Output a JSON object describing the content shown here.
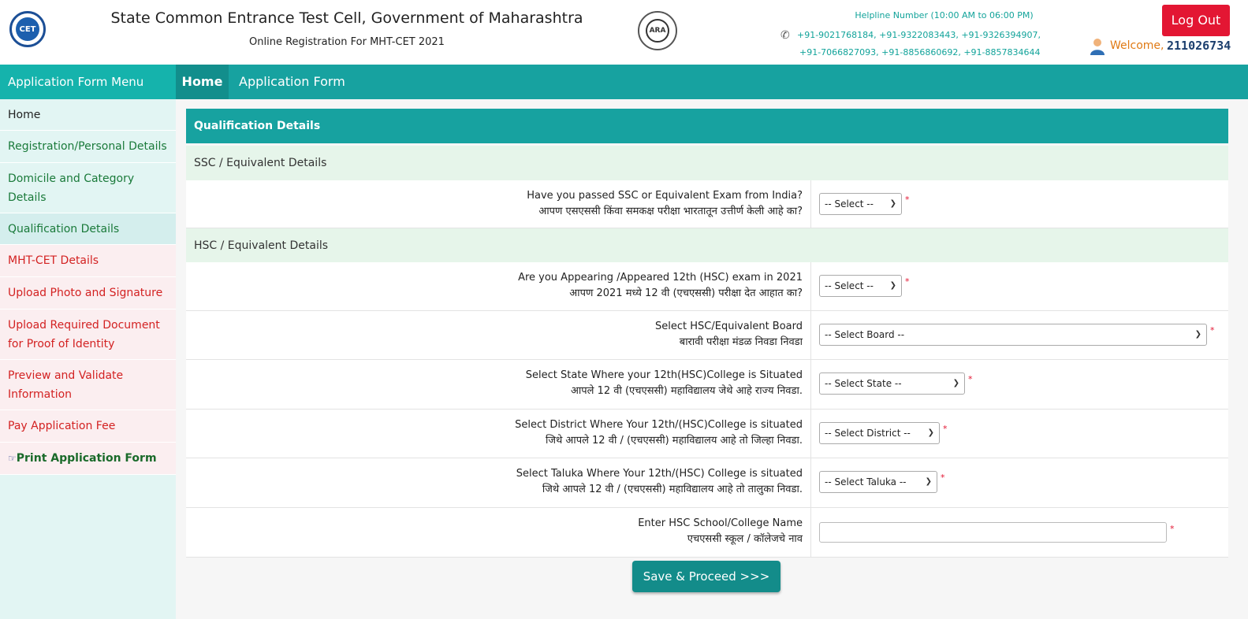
{
  "header": {
    "title": "State Common Entrance Test Cell, Government of Maharashtra",
    "subtitle": "Online Registration For MHT-CET 2021",
    "cet_logo_text": "CET",
    "ara_logo_text": "ARA",
    "helpline_title": "Helpline Number (10:00 AM to 06:00 PM)",
    "helpline_line1": "+91-9021768184, +91-9322083443, +91-9326394907,",
    "helpline_line2": "+91-7066827093, +91-8856860692, +91-8857834644",
    "logout_label": "Log Out",
    "welcome_label": "Welcome,",
    "user_id": "211026734"
  },
  "nav": {
    "sidebar_title": "Application Form Menu",
    "tabs": [
      {
        "label": "Home",
        "active": true
      },
      {
        "label": "Application Form",
        "active": false
      }
    ]
  },
  "sidebar": {
    "items": [
      {
        "label": "Home",
        "status": "neutral"
      },
      {
        "label": "Registration/Personal Details",
        "status": "complete"
      },
      {
        "label": "Domicile and Category Details",
        "status": "complete"
      },
      {
        "label": "Qualification Details",
        "status": "active"
      },
      {
        "label": "MHT-CET Details",
        "status": "pending"
      },
      {
        "label": "Upload Photo and Signature",
        "status": "pending"
      },
      {
        "label": "Upload Required Document for Proof of Identity",
        "status": "pending"
      },
      {
        "label": "Preview and Validate Information",
        "status": "pending"
      },
      {
        "label": "Pay Application Fee",
        "status": "pending"
      },
      {
        "label": "Print Application Form",
        "status": "complete",
        "icon": "pointing-hand-icon"
      }
    ]
  },
  "form": {
    "panel_title": "Qualification Details",
    "ssc_section": "SSC / Equivalent Details",
    "hsc_section": "HSC / Equivalent Details",
    "fields": [
      {
        "label_en": "Have you passed SSC or Equivalent Exam from India?",
        "label_mr": "आपण एसएससी किंवा समकक्ष परीक्षा भारतातून उत्तीर्ण केली आहे का?",
        "value": "-- Select --",
        "required": "*"
      },
      {
        "label_en": "Are you Appearing /Appeared 12th (HSC) exam in 2021",
        "label_mr": "आपण 2021 मध्ये 12 वी (एचएससी) परीक्षा देत आहात का?",
        "value": "-- Select --",
        "required": "*"
      },
      {
        "label_en": "Select HSC/Equivalent Board",
        "label_mr": "बारावी परीक्षा मंडळ निवडा निवडा",
        "value": "-- Select Board --",
        "required": "*"
      },
      {
        "label_en": "Select State Where your 12th(HSC)College is Situated",
        "label_mr": "आपले 12 वी (एचएससी) महाविद्यालय जेथे आहे राज्य निवडा.",
        "value": "-- Select State --",
        "required": "*"
      },
      {
        "label_en": "Select District Where Your 12th/(HSC)College is situated",
        "label_mr": "जिथे आपले 12 वी / (एचएससी) महाविद्यालय आहे तो जिल्हा निवडा.",
        "value": "-- Select District --",
        "required": "*"
      },
      {
        "label_en": "Select Taluka Where Your 12th/(HSC) College is situated",
        "label_mr": "जिथे आपले 12 वी / (एचएससी) महाविद्यालय आहे तो तालुका निवडा.",
        "value": "-- Select Taluka --",
        "required": "*"
      },
      {
        "label_en": "Enter HSC School/College Name",
        "label_mr": "एचएससी स्कूल / कॉलेजचे नाव",
        "value": "",
        "required": "*"
      }
    ],
    "save_label": "Save & Proceed >>>"
  },
  "colors": {
    "teal": "#17a2a0",
    "teal_dark": "#128e8c",
    "logout_red": "#e31633",
    "complete_green": "#1a7a3a",
    "pending_red": "#d32222"
  }
}
